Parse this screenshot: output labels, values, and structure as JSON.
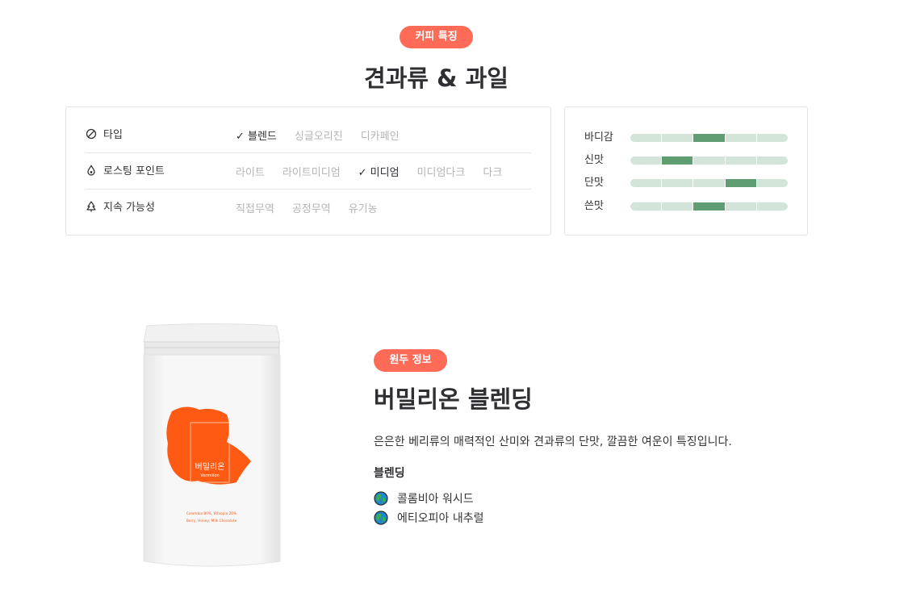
{
  "feature_section": {
    "badge": "커피 특징",
    "title": "견과류 & 과일"
  },
  "attributes": [
    {
      "label": "타입",
      "icon": "leaf-icon",
      "options": [
        {
          "text": "블렌드",
          "selected": true
        },
        {
          "text": "싱글오리진",
          "selected": false
        },
        {
          "text": "디카페인",
          "selected": false
        }
      ]
    },
    {
      "label": "로스팅 포인트",
      "icon": "drop-icon",
      "options": [
        {
          "text": "라이트",
          "selected": false
        },
        {
          "text": "라이트미디엄",
          "selected": false
        },
        {
          "text": "미디엄",
          "selected": true
        },
        {
          "text": "미디엄다크",
          "selected": false
        },
        {
          "text": "다크",
          "selected": false
        }
      ]
    },
    {
      "label": "지속 가능성",
      "icon": "tree-icon",
      "options": [
        {
          "text": "직접무역",
          "selected": false
        },
        {
          "text": "공정무역",
          "selected": false
        },
        {
          "text": "유기농",
          "selected": false
        }
      ]
    }
  ],
  "taste_profile": [
    {
      "label": "바디감",
      "level": 3,
      "max": 5
    },
    {
      "label": "신맛",
      "level": 2,
      "max": 5
    },
    {
      "label": "단맛",
      "level": 4,
      "max": 5
    },
    {
      "label": "쓴맛",
      "level": 3,
      "max": 5
    }
  ],
  "product_image": {
    "name": "버밀리온",
    "subtitle": "Vermilion",
    "origin_line": "Colombia 80%, Ethiopia 20%",
    "notes_line": "Berry, Honey, Milk Chocolate"
  },
  "bean_section": {
    "badge": "원두 정보",
    "title": "버밀리온 블렌딩",
    "description": "은은한 베리류의 매력적인 산미와 견과류의 단맛, 깔끔한 여운이 특징입니다.",
    "blend_heading": "블렌딩",
    "origins": [
      "콜롬비아 워시드",
      "에티오피아 내추럴"
    ]
  },
  "colors": {
    "accent": "#ff6b57",
    "bar_bg": "#d3e4d9",
    "bar_fill": "#5f9d72",
    "label_orange": "#ff5a14"
  }
}
